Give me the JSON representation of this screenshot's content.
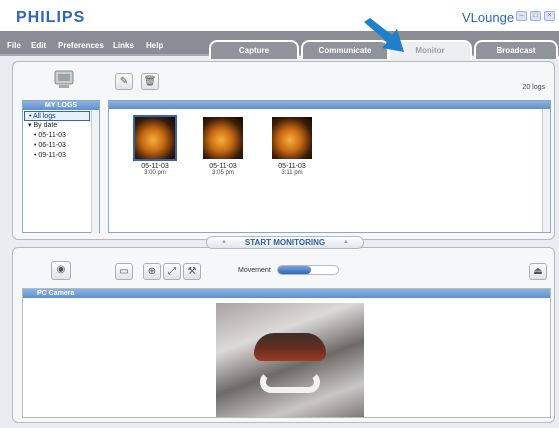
{
  "app": {
    "brand": "PHILIPS",
    "name": "VLounge"
  },
  "window_buttons": [
    "minimize-icon",
    "restore-icon",
    "close-icon"
  ],
  "menu": [
    "File",
    "Edit",
    "Preferences",
    "Links",
    "Help"
  ],
  "tabs": [
    {
      "label": "Capture",
      "active": false
    },
    {
      "label": "Communicate",
      "active": false
    },
    {
      "label": "Monitor",
      "active": true
    },
    {
      "label": "Broadcast",
      "active": false
    }
  ],
  "logs": {
    "count": "20 logs",
    "panel_title": "MY LOGS",
    "tree": [
      {
        "label": "All logs",
        "selected": true
      },
      {
        "label": "By date",
        "selected": false
      },
      {
        "label": "05-11-03",
        "selected": false
      },
      {
        "label": "06-11-03",
        "selected": false
      },
      {
        "label": "09-11-03",
        "selected": false
      }
    ],
    "thumbnails": [
      {
        "date": "05-11-03",
        "time": "3:00 pm"
      },
      {
        "date": "05-11-03",
        "time": "3:05 pm"
      },
      {
        "date": "05-11-03",
        "time": "3:11 pm"
      }
    ]
  },
  "start_button": "START MONITORING",
  "movement": {
    "label": "Movement",
    "level": 0.55
  },
  "camera": {
    "panel_title": "PC Camera"
  },
  "colors": {
    "accent": "#2f67b6",
    "menubar": "#8a8e94",
    "header_blue": "#5f8fce"
  }
}
